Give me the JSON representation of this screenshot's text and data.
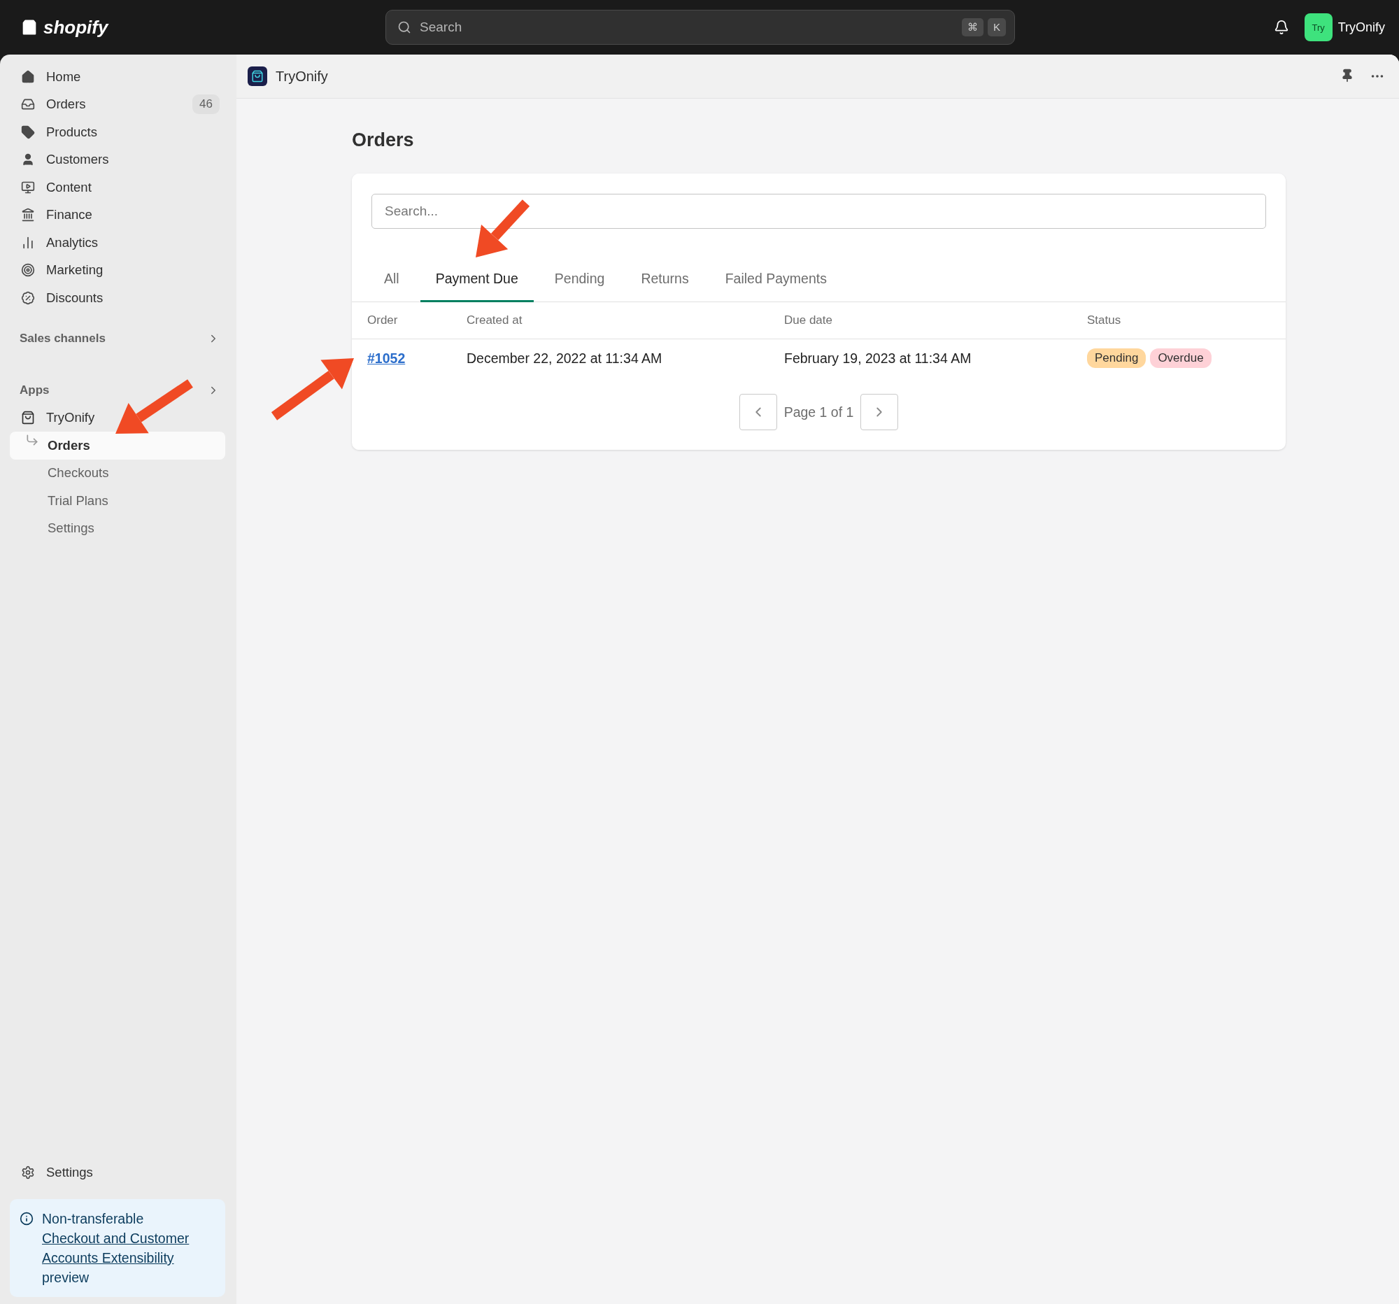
{
  "topbar": {
    "logo": "shopify",
    "search": {
      "placeholder": "Search",
      "shortcut": [
        "⌘",
        "K"
      ]
    },
    "store": {
      "avatar": "Try",
      "name": "TryOnify"
    }
  },
  "sidebar": {
    "items": [
      {
        "label": "Home"
      },
      {
        "label": "Orders",
        "badge": "46"
      },
      {
        "label": "Products"
      },
      {
        "label": "Customers"
      },
      {
        "label": "Content"
      },
      {
        "label": "Finance"
      },
      {
        "label": "Analytics"
      },
      {
        "label": "Marketing"
      },
      {
        "label": "Discounts"
      }
    ],
    "sales_channels": "Sales channels",
    "apps": {
      "title": "Apps",
      "app": "TryOnify",
      "children": [
        {
          "label": "Orders",
          "selected": true
        },
        {
          "label": "Checkouts",
          "selected": false
        },
        {
          "label": "Trial Plans",
          "selected": false
        },
        {
          "label": "Settings",
          "selected": false
        }
      ]
    },
    "settings": "Settings",
    "notice": {
      "text": "Non-transferable",
      "link": "Checkout and Customer Accounts Extensibility",
      "suffix": "preview"
    }
  },
  "app_header": {
    "title": "TryOnify"
  },
  "page": {
    "title": "Orders",
    "search": {
      "placeholder": "Search..."
    },
    "tabs": [
      {
        "label": "All",
        "selected": false
      },
      {
        "label": "Payment Due",
        "selected": true
      },
      {
        "label": "Pending",
        "selected": false
      },
      {
        "label": "Returns",
        "selected": false
      },
      {
        "label": "Failed Payments",
        "selected": false
      }
    ],
    "table": {
      "columns": [
        "Order",
        "Created at",
        "Due date",
        "Status"
      ],
      "rows": [
        {
          "order": "#1052",
          "created_at": "December 22, 2022 at 11:34 AM",
          "due_date": "February 19, 2023 at 11:34 AM",
          "status": [
            {
              "label": "Pending",
              "kind": "warning"
            },
            {
              "label": "Overdue",
              "kind": "critical"
            }
          ]
        }
      ]
    },
    "pagination": {
      "label": "Page 1 of 1"
    }
  }
}
